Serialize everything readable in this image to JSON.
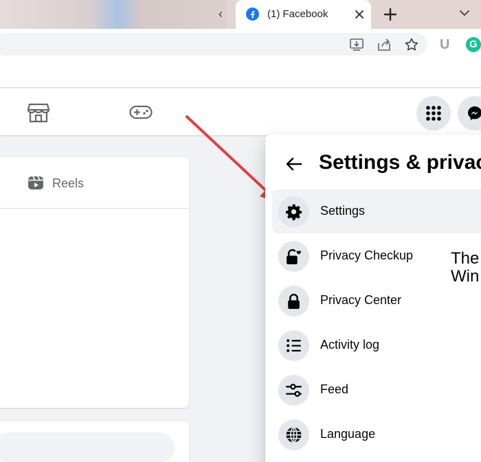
{
  "browser": {
    "active_tab_title": "(1) Facebook",
    "accent": "#1877f2"
  },
  "extensions": {
    "u_label": "U",
    "g_label": "G"
  },
  "feed": {
    "reels_label": "Reels"
  },
  "settings_panel": {
    "title": "Settings & privacy",
    "items": [
      {
        "label": "Settings",
        "icon": "gear-icon"
      },
      {
        "label": "Privacy Checkup",
        "icon": "lock-heart-icon"
      },
      {
        "label": "Privacy Center",
        "icon": "lock-icon"
      },
      {
        "label": "Activity log",
        "icon": "list-icon"
      },
      {
        "label": "Feed",
        "icon": "sliders-icon"
      },
      {
        "label": "Language",
        "icon": "globe-icon"
      }
    ],
    "overlay_text": "The\nWin"
  },
  "annotation": {
    "arrow_color": "#e0403f"
  }
}
